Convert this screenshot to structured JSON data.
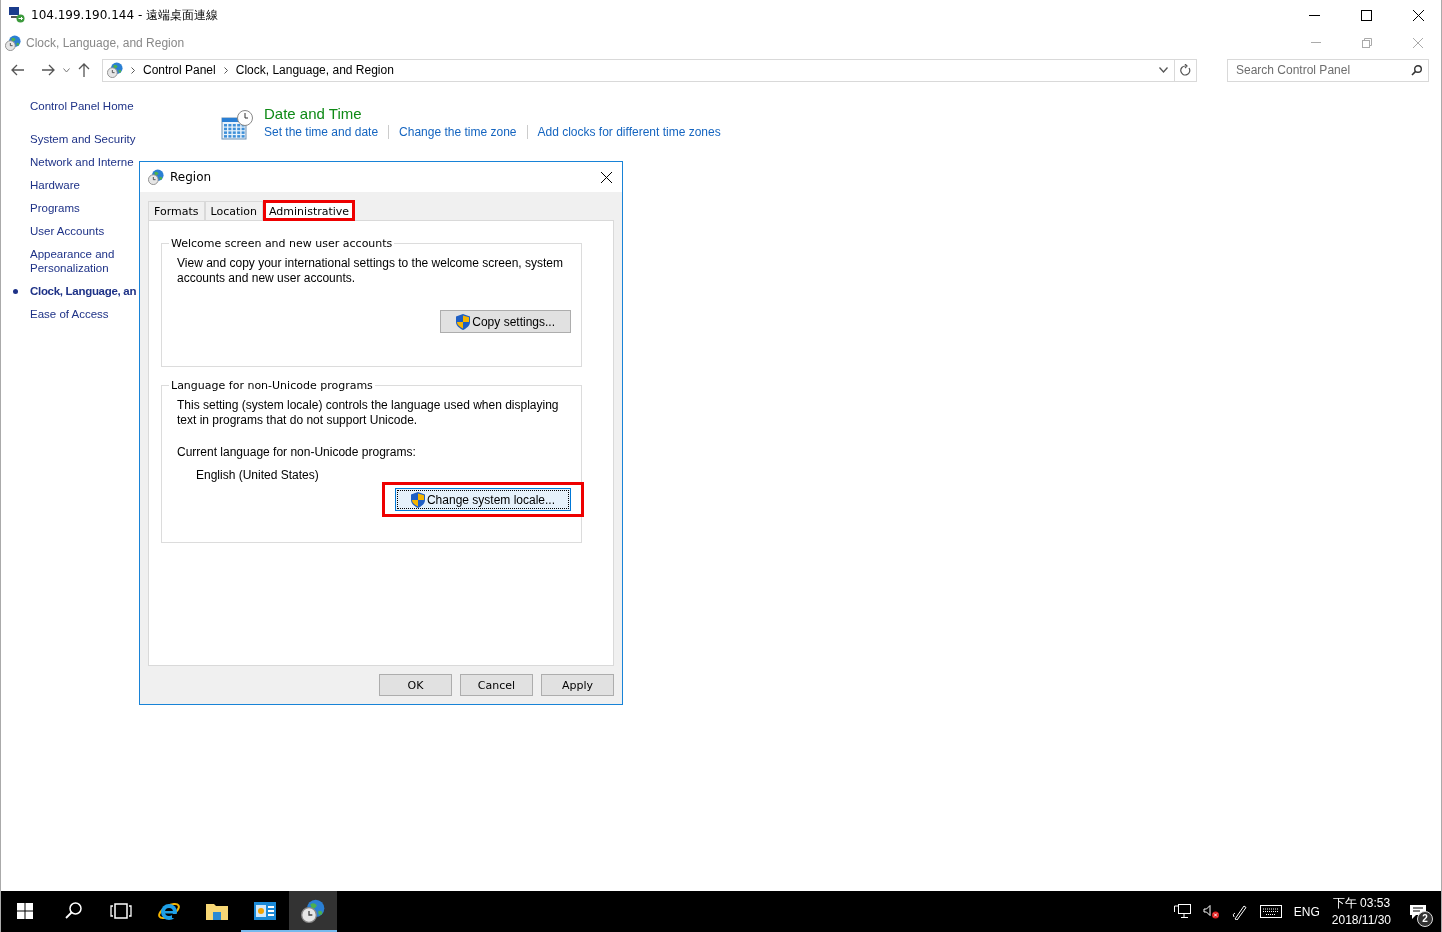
{
  "remote_window": {
    "title": "104.199.190.144 - 遠端桌面連線"
  },
  "explorer": {
    "title": "Clock, Language, and Region",
    "breadcrumb": [
      "Control Panel",
      "Clock, Language, and Region"
    ],
    "search": {
      "placeholder": "Search Control Panel"
    }
  },
  "sidebar": {
    "home": "Control Panel Home",
    "items": [
      {
        "label": "System and Security",
        "selected": false
      },
      {
        "label": "Network and Interne",
        "selected": false
      },
      {
        "label": "Hardware",
        "selected": false
      },
      {
        "label": "Programs",
        "selected": false
      },
      {
        "label": "User Accounts",
        "selected": false
      },
      {
        "label": "Appearance and\nPersonalization",
        "selected": false
      },
      {
        "label": "Clock, Language, an",
        "selected": true
      },
      {
        "label": "Ease of Access",
        "selected": false
      }
    ]
  },
  "categories": [
    {
      "title": "Date and Time",
      "links": [
        "Set the time and date",
        "Change the time zone",
        "Add clocks for different time zones"
      ]
    }
  ],
  "dialog": {
    "title": "Region",
    "tabs": [
      {
        "label": "Formats",
        "selected": false,
        "highlighted": false
      },
      {
        "label": "Location",
        "selected": false,
        "highlighted": false
      },
      {
        "label": "Administrative",
        "selected": true,
        "highlighted": true
      }
    ],
    "groups": [
      {
        "title": "Welcome screen and new user accounts",
        "text": "View and copy your international settings to the welcome screen, system accounts and new user accounts.",
        "button": {
          "label": "Copy settings...",
          "highlighted": false,
          "focused": false
        }
      },
      {
        "title": "Language for non-Unicode programs",
        "text": "This setting (system locale) controls the language used when displaying text in programs that do not support Unicode.",
        "current_label": "Current language for non-Unicode programs:",
        "current_value": "English (United States)",
        "button": {
          "label": "Change system locale...",
          "highlighted": true,
          "focused": true
        }
      }
    ],
    "buttons": [
      "OK",
      "Cancel",
      "Apply"
    ]
  },
  "taskbar": {
    "apps": [
      {
        "kind": "start",
        "running": false,
        "selected": false
      },
      {
        "kind": "search",
        "running": false,
        "selected": false
      },
      {
        "kind": "taskview",
        "running": false,
        "selected": false
      },
      {
        "kind": "browser",
        "running": false,
        "selected": false
      },
      {
        "kind": "folder",
        "running": false,
        "selected": false
      },
      {
        "kind": "controlpanel",
        "running": true,
        "selected": false
      },
      {
        "kind": "region",
        "running": true,
        "selected": true
      }
    ],
    "language": "ENG",
    "time": "下午 03:53",
    "date": "2018/11/30",
    "notifications": "2"
  }
}
